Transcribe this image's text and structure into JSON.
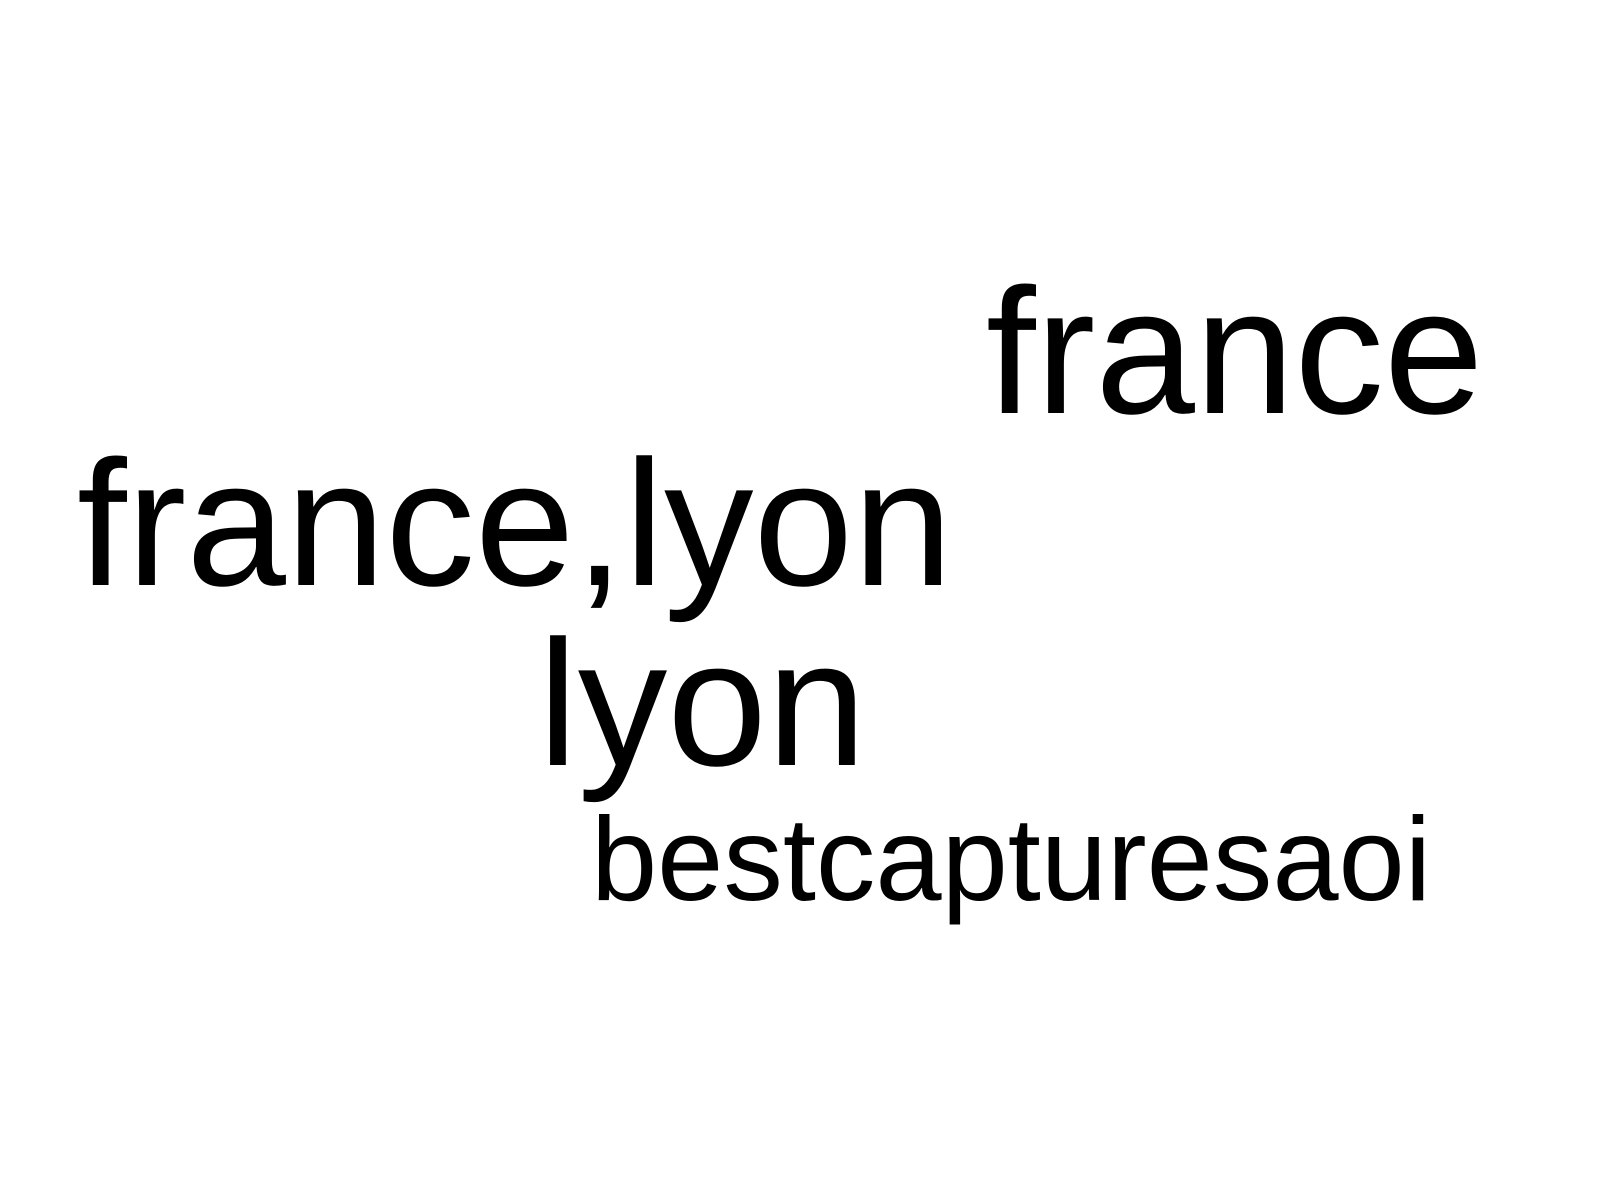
{
  "background_color": "#ffffff",
  "text_color": "#000000",
  "words": {
    "line1": "france",
    "line2": "france,lyon",
    "line3": "lyon",
    "line4": "bestcapturesaoi"
  }
}
